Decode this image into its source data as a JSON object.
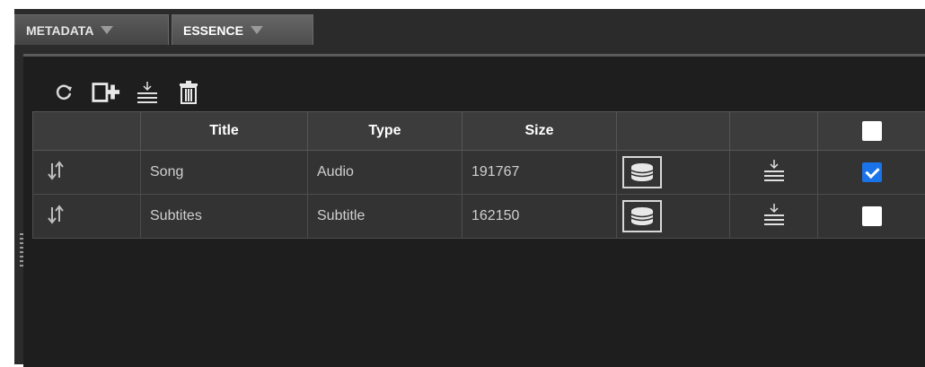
{
  "tabs": [
    {
      "label": "METADATA",
      "active": false
    },
    {
      "label": "ESSENCE",
      "active": true
    }
  ],
  "toolbar": {
    "icons": [
      "refresh-icon",
      "add-file-icon",
      "download-icon",
      "trash-icon"
    ]
  },
  "table": {
    "headers": [
      "",
      "Title",
      "Type",
      "Size",
      "",
      "",
      ""
    ],
    "rows": [
      {
        "title": "Song",
        "type": "Audio",
        "size": "191767",
        "checked": true
      },
      {
        "title": "Subtites",
        "type": "Subtitle",
        "size": "162150",
        "checked": false
      }
    ]
  },
  "colors": {
    "background": "#1e1e1e",
    "header": "#3c3c3c",
    "row": "#333333",
    "accent": "#1a73e8"
  }
}
